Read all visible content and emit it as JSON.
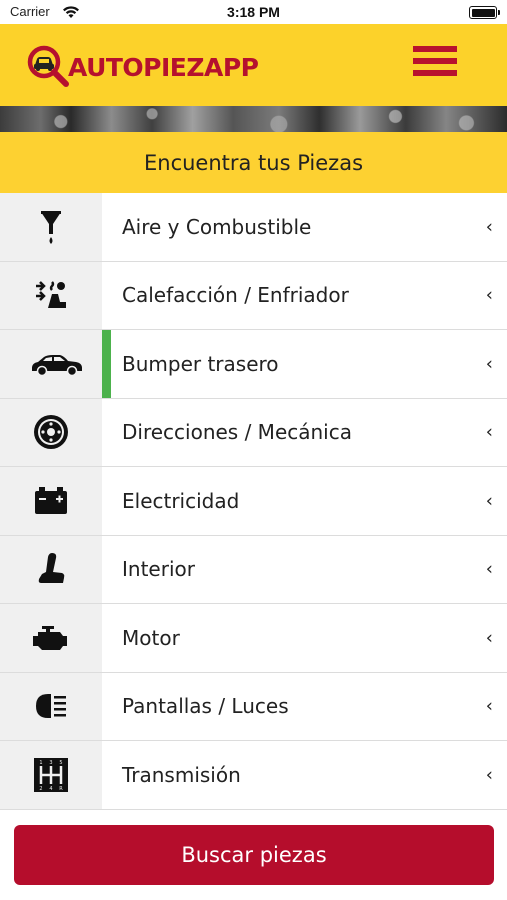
{
  "status_bar": {
    "carrier": "Carrier",
    "time": "3:18 PM"
  },
  "header": {
    "logo_part_a": "AUTOPIEZ",
    "logo_part_b": "APP",
    "menu_icon": "hamburger-menu-icon"
  },
  "section": {
    "title": "Encuentra tus Piezas"
  },
  "categories": [
    {
      "label": "Aire y Combustible",
      "icon": "funnel-icon"
    },
    {
      "label": "Calefacción / Enfriador",
      "icon": "car-seat-heat-icon"
    },
    {
      "label": "Bumper trasero",
      "icon": "car-icon",
      "selected": true
    },
    {
      "label": "Direcciones / Mecánica",
      "icon": "brake-disc-icon"
    },
    {
      "label": "Electricidad",
      "icon": "battery-icon"
    },
    {
      "label": "Interior",
      "icon": "seat-icon"
    },
    {
      "label": "Motor",
      "icon": "engine-icon"
    },
    {
      "label": "Pantallas / Luces",
      "icon": "headlight-icon"
    },
    {
      "label": "Transmisión",
      "icon": "gear-shift-icon"
    }
  ],
  "chevron": "‹",
  "search_button": {
    "label": "Buscar piezas"
  },
  "colors": {
    "header": "#fcd22a",
    "brand_red": "#b50d2c",
    "selected_marker": "#4cb24c",
    "icon_cell": "#f0f0f0"
  }
}
